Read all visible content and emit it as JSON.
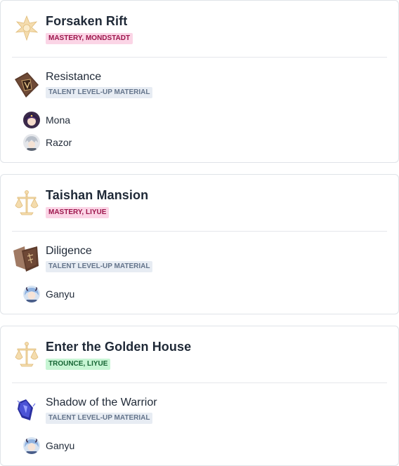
{
  "cards": [
    {
      "domain": "Forsaken Rift",
      "badge": "MASTERY, MONDSTADT",
      "material": "Resistance",
      "material_tag": "TALENT LEVEL-UP MATERIAL",
      "characters": [
        "Mona",
        "Razor"
      ]
    },
    {
      "domain": "Taishan Mansion",
      "badge": "MASTERY, LIYUE",
      "material": "Diligence",
      "material_tag": "TALENT LEVEL-UP MATERIAL",
      "characters": [
        "Ganyu"
      ]
    },
    {
      "domain": "Enter the Golden House",
      "badge": "TROUNCE, LIYUE",
      "material": "Shadow of the Warrior",
      "material_tag": "TALENT LEVEL-UP MATERIAL",
      "characters": [
        "Ganyu"
      ]
    }
  ],
  "colors": {
    "mastery_badge_bg": "#fbd5e6",
    "trounce_badge_bg": "#c7f5d4",
    "tag_bg": "#e7ecf3"
  },
  "icons": [
    "mondstadt-emblem-icon",
    "liyue-emblem-icon",
    "resistance-book-icon",
    "diligence-book-icon",
    "shadow-warrior-icon",
    "mona-avatar",
    "razor-avatar",
    "ganyu-avatar"
  ]
}
